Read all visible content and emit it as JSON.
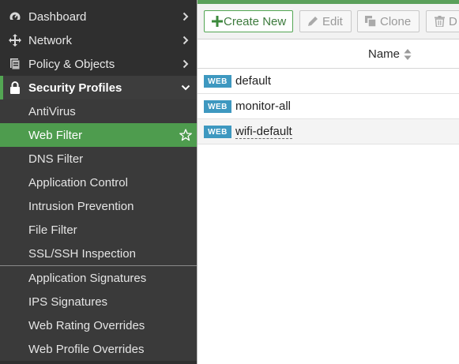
{
  "sidebar": {
    "items": [
      {
        "label": "Dashboard",
        "icon": "dashboard-icon"
      },
      {
        "label": "Network",
        "icon": "network-icon"
      },
      {
        "label": "Policy & Objects",
        "icon": "policy-icon"
      },
      {
        "label": "Security Profiles",
        "icon": "lock-icon"
      }
    ],
    "sub_items": [
      {
        "label": "AntiVirus"
      },
      {
        "label": "Web Filter"
      },
      {
        "label": "DNS Filter"
      },
      {
        "label": "Application Control"
      },
      {
        "label": "Intrusion Prevention"
      },
      {
        "label": "File Filter"
      },
      {
        "label": "SSL/SSH Inspection"
      },
      {
        "label": "Application Signatures"
      },
      {
        "label": "IPS Signatures"
      },
      {
        "label": "Web Rating Overrides"
      },
      {
        "label": "Web Profile Overrides"
      }
    ],
    "active_sub_item": "Web Filter"
  },
  "toolbar": {
    "create_label": "Create New",
    "edit_label": "Edit",
    "clone_label": "Clone",
    "delete_label": "D"
  },
  "table": {
    "columns": [
      "Name"
    ],
    "rows": [
      {
        "badge": "WEB",
        "name": "default"
      },
      {
        "badge": "WEB",
        "name": "monitor-all"
      },
      {
        "badge": "WEB",
        "name": "wifi-default"
      }
    ]
  },
  "colors": {
    "accent_green": "#53a653",
    "badge_blue": "#3e98c0",
    "sidebar_bg": "#2f2f2f"
  }
}
